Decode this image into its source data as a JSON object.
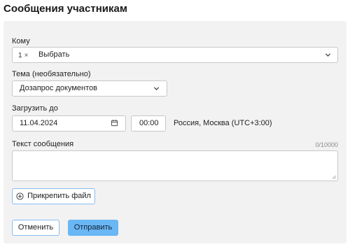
{
  "header": {
    "title": "Сообщения участникам"
  },
  "form": {
    "recipients": {
      "label": "Кому",
      "chip_count": "1",
      "chip_remove": "×",
      "placeholder": "Выбрать"
    },
    "subject": {
      "label": "Тема (необязательно)",
      "value": "Дозапрос документов"
    },
    "deadline": {
      "label": "Загрузить до",
      "date": "11.04.2024",
      "time": "00:00",
      "timezone": "Россия, Москва (UTC+3:00)"
    },
    "message": {
      "label": "Текст сообщения",
      "counter": "0/10000",
      "value": ""
    },
    "attach_label": "Прикрепить файл"
  },
  "actions": {
    "cancel_label": "Отменить",
    "send_label": "Отправить"
  },
  "colors": {
    "panel_bg": "#f2f2f2",
    "primary": "#6ab7f5",
    "outline": "#8bbcf0"
  },
  "icons": [
    "chevron-down-icon",
    "calendar-icon",
    "plus-circle-icon",
    "close-icon"
  ]
}
